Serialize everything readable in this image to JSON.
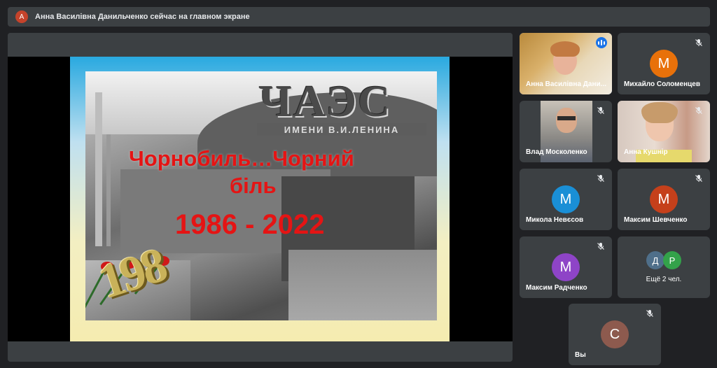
{
  "banner": {
    "avatar_letter": "А",
    "text": "Анна Василівна Данильченко сейчас на главном экране"
  },
  "slide": {
    "header_text": "ЧАЭС",
    "header_subline": "ИМЕНИ В.И.ЛЕНИНА",
    "title_line1": "Чорнобиль…Чорний",
    "title_line2": "біль",
    "years": "1986 - 2022",
    "decor_digits": "198"
  },
  "participants": [
    {
      "name": "Анна Василівна Дани...",
      "kind": "video",
      "speaking": true
    },
    {
      "name": "Михайло Соломенцев",
      "kind": "avatar",
      "letter": "М",
      "color": "#e8710a",
      "muted": true
    },
    {
      "name": "Влад Москоленко",
      "kind": "video",
      "muted": true
    },
    {
      "name": "Анна Кушнір",
      "kind": "video",
      "muted": true
    },
    {
      "name": "Микола Невєсов",
      "kind": "avatar",
      "letter": "М",
      "color": "#1a8fd6",
      "muted": true
    },
    {
      "name": "Максим Шевченко",
      "kind": "avatar",
      "letter": "М",
      "color": "#c5401b",
      "muted": true
    },
    {
      "name": "Максим Радченко",
      "kind": "avatar",
      "letter": "М",
      "color": "#8e44c7",
      "muted": true
    },
    {
      "name": "Ещё 2 чел.",
      "kind": "group",
      "letters": [
        "Д",
        "Р"
      ],
      "colors": [
        "#4f6f8a",
        "#33a24a"
      ],
      "muted": false
    },
    {
      "name": "Вы",
      "kind": "avatar",
      "letter": "С",
      "color": "#8d5a4e",
      "muted": true
    }
  ],
  "icons": {
    "muted": "mic-off-icon",
    "speaking": "audio-level-icon"
  }
}
